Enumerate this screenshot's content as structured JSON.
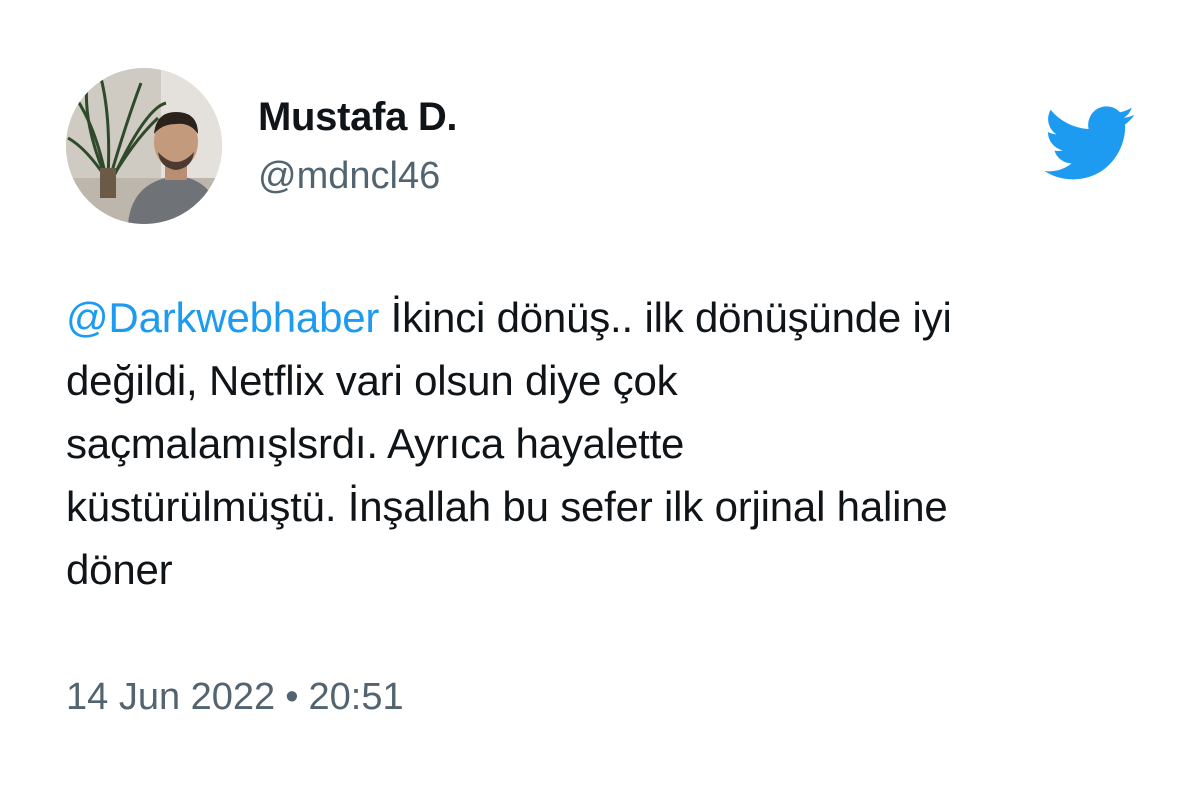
{
  "user": {
    "display_name": "Mustafa D.",
    "handle": "@mdncl46"
  },
  "brand": {
    "logo_icon": "twitter-bird-icon",
    "accent_color": "#1d9bf0"
  },
  "tweet": {
    "mention": "@Darkwebhaber",
    "lines": [
      " İkinci dönüş.. ilk dönüşünde iyi",
      "değildi, Netflix vari olsun diye çok",
      "saçmalamışlsrdı. Ayrıca hayalette",
      "küstürülmüştü. İnşallah bu sefer ilk orjinal haline",
      "döner"
    ]
  },
  "meta": {
    "date": "14 Jun 2022",
    "separator": "•",
    "time": "20:51"
  }
}
